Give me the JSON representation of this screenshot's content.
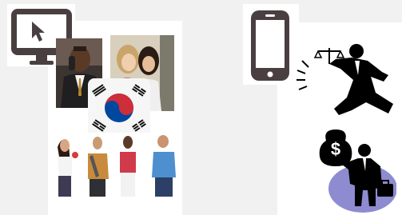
{
  "left_group": {
    "device_icon": "desktop-monitor-cursor-icon",
    "photos": [
      "man-on-phone-photo",
      "two-women-photo",
      "south-korea-flag",
      "four-people-group-photo"
    ]
  },
  "right_group": {
    "device_icon": "smartphone-icon",
    "clipart": [
      "businessman-holding-scales-icon",
      "businessman-holding-money-bag-icon"
    ],
    "money_bag_symbol": "$"
  },
  "colors": {
    "background": "#f1f1f1",
    "panel": "#ffffff",
    "icon_dark": "#4a3f40",
    "clipart_black": "#000000",
    "circle_purple": "#8e8bd0",
    "flag_red": "#cd2e3a",
    "flag_blue": "#0047a0"
  }
}
